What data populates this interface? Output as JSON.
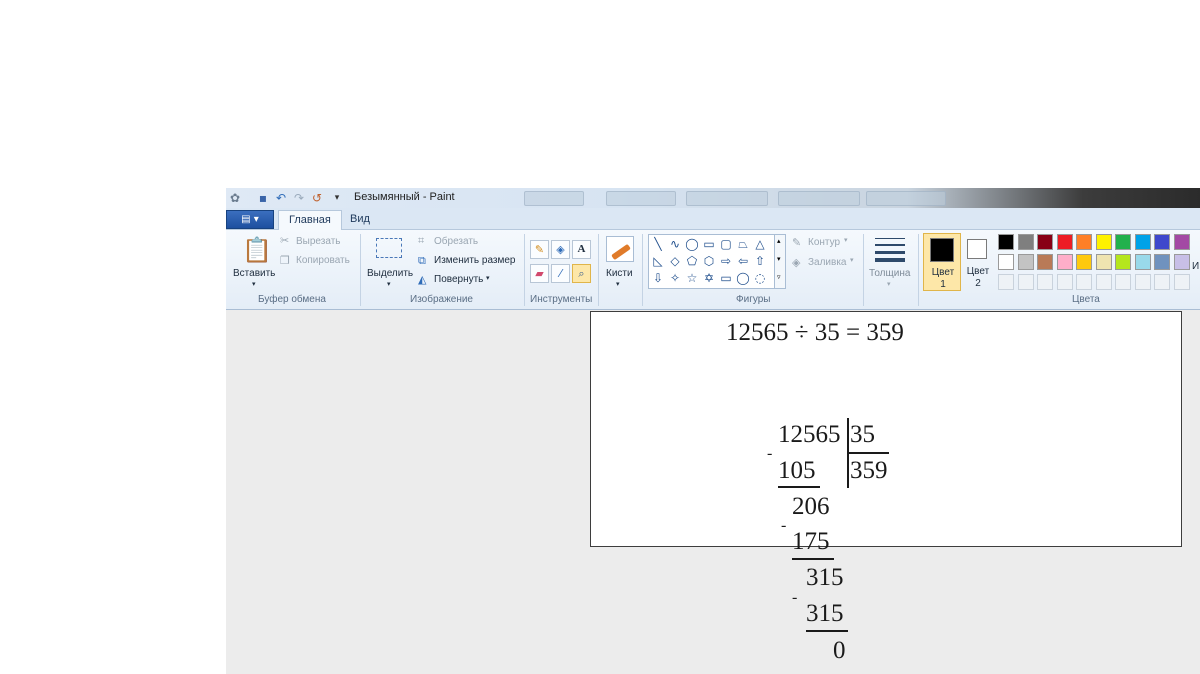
{
  "window": {
    "title": "Безымянный - Paint"
  },
  "tabs": {
    "home": "Главная",
    "view": "Вид"
  },
  "clipboard": {
    "paste": "Вставить",
    "cut": "Вырезать",
    "copy": "Копировать",
    "group": "Буфер обмена"
  },
  "image": {
    "select": "Выделить",
    "crop": "Обрезать",
    "resize": "Изменить размер",
    "rotate": "Повернуть",
    "group": "Изображение"
  },
  "tools": {
    "group": "Инструменты"
  },
  "brushes": {
    "label": "Кисти"
  },
  "shapes": {
    "outline": "Контур",
    "fill": "Заливка",
    "group": "Фигуры"
  },
  "size": {
    "label": "Толщина"
  },
  "colors": {
    "color1": "Цвет 1",
    "color2": "Цвет 2",
    "group": "Цвета",
    "edit_partial": "И",
    "color1_value": "#000000",
    "color2_value": "#ffffff",
    "palette_row1": [
      "#000000",
      "#7f7f7f",
      "#880015",
      "#ed1c24",
      "#ff7f27",
      "#fff200",
      "#22b14c",
      "#00a2e8",
      "#3f48cc",
      "#a349a4"
    ],
    "palette_row2": [
      "#ffffff",
      "#c3c3c3",
      "#b97a57",
      "#ffaec9",
      "#ffc90e",
      "#efe4b0",
      "#b5e61d",
      "#99d9ea",
      "#7092be",
      "#c8bfe7"
    ]
  },
  "canvas": {
    "equation": "12565 ÷ 35  = 359",
    "dividend": "12565",
    "divisor": "35",
    "quotient": "359",
    "step1": "105",
    "step2": "206",
    "step3": "175",
    "step4": "315",
    "step5": "315",
    "remainder": "0",
    "minus": "-"
  }
}
